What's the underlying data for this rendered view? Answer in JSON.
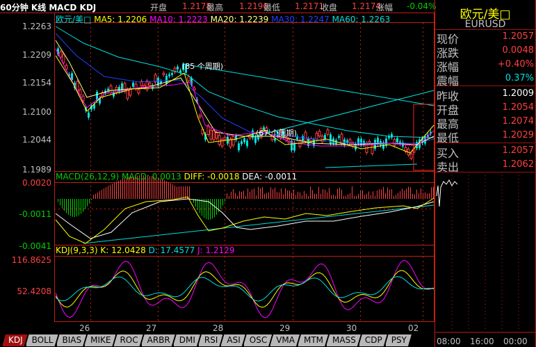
{
  "header": {
    "title": "60分钟 K线 MACD KDJ",
    "open_label": "开盘",
    "open": "1.2178",
    "high_label": "最高",
    "high": "1.2190",
    "low_label": "最低",
    "low": "1.2171",
    "close_label": "收盘",
    "close": "1.2174",
    "change_label": "涨幅",
    "change": "-0.04%"
  },
  "main": {
    "symbol": "欧元/美□",
    "ma5": "MA5: 1.2206",
    "ma10": "MA10: 1.2223",
    "ma20": "MA20: 1.2239",
    "ma30": "MA30: 1.2247",
    "ma60": "MA60: 1.2263",
    "y_ticks": [
      "1.2263",
      "1.2209",
      "1.2154",
      "1.2100",
      "1.2044",
      "1.1989"
    ],
    "annotations": [
      "(85 个周期)",
      "(67 个周期)"
    ]
  },
  "macd": {
    "title": "MACD(26,12,9)",
    "macd": "MACD: 0.0013",
    "diff": "DIFF: -0.0018",
    "dea": "DEA: -0.0011",
    "y_ticks": [
      "0.0020",
      "-0.0011",
      "-0.0041"
    ]
  },
  "kdj": {
    "title": "KDJ(9,3,3)",
    "k": "K: 12.0428",
    "d": "D: 17.4577",
    "j": "J: 1.2129",
    "y_ticks": [
      "116.8625",
      "52.4208"
    ]
  },
  "x_ticks": [
    "26",
    "27",
    "28",
    "29",
    "30",
    "02"
  ],
  "tabs": [
    "KDJ",
    "BOLL",
    "BIAS",
    "MIKE",
    "ROC",
    "ARBR",
    "DMI",
    "RSI",
    "ASI",
    "OSC",
    "VMA",
    "MTM",
    "MASS",
    "CDP",
    "PSY"
  ],
  "active_tab": "KDJ",
  "quote": {
    "name": "欧元/美□",
    "code": "EURUSD",
    "rows": [
      {
        "label": "现价",
        "value": "1.2057",
        "color": "#ff4040"
      },
      {
        "label": "涨跌",
        "value": "0.0048",
        "color": "#ff4040"
      },
      {
        "label": "涨幅",
        "value": "+0.40%",
        "color": "#ff4040"
      },
      {
        "label": "震幅",
        "value": "0.37%",
        "color": "#00e0e0"
      },
      {
        "label": "昨收",
        "value": "1.2009",
        "color": "#ffffff"
      },
      {
        "label": "开盘",
        "value": "1.2054",
        "color": "#ff4040"
      },
      {
        "label": "最高",
        "value": "1.2074",
        "color": "#ff4040"
      },
      {
        "label": "最低",
        "value": "1.2029",
        "color": "#ff4040"
      },
      {
        "label": "买入",
        "value": "1.2057",
        "color": "#ff4040"
      },
      {
        "label": "卖出",
        "value": "1.2062",
        "color": "#ff4040"
      }
    ],
    "time_ticks": [
      "08:00",
      "16:00",
      "00:00"
    ]
  }
}
